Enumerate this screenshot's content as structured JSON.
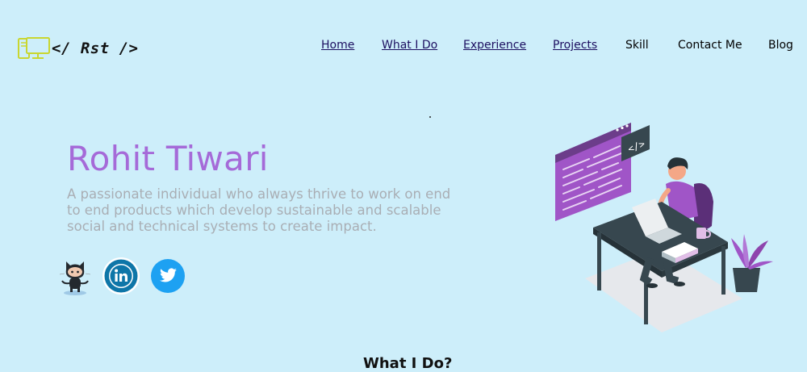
{
  "header": {
    "logo_text": "</ Rst />",
    "logo_icon": "devices-icon",
    "nav": [
      {
        "label": "Home"
      },
      {
        "label": "What I Do"
      },
      {
        "label": "Experience"
      },
      {
        "label": "Projects"
      },
      {
        "label": "Skill"
      },
      {
        "label": "Contact Me"
      },
      {
        "label": "Blog"
      }
    ]
  },
  "hero": {
    "name": "Rohit Tiwari",
    "description": "A passionate individual who always thrive to work on end to end products which develop sustainable and scalable social and technical systems to create impact.",
    "social": [
      {
        "icon": "github-octocat-icon"
      },
      {
        "icon": "linkedin-icon"
      },
      {
        "icon": "twitter-icon"
      }
    ],
    "illustration": "developer-at-desk-illustration"
  },
  "next_section": {
    "heading": "What I Do?"
  },
  "colors": {
    "background": "#cdeefa",
    "accent_purple": "#a56ad8",
    "text_muted": "#a9aeb4",
    "link": "#1c0f60",
    "linkedin_blue": "#0e76a8",
    "twitter_blue": "#1da1f2"
  }
}
